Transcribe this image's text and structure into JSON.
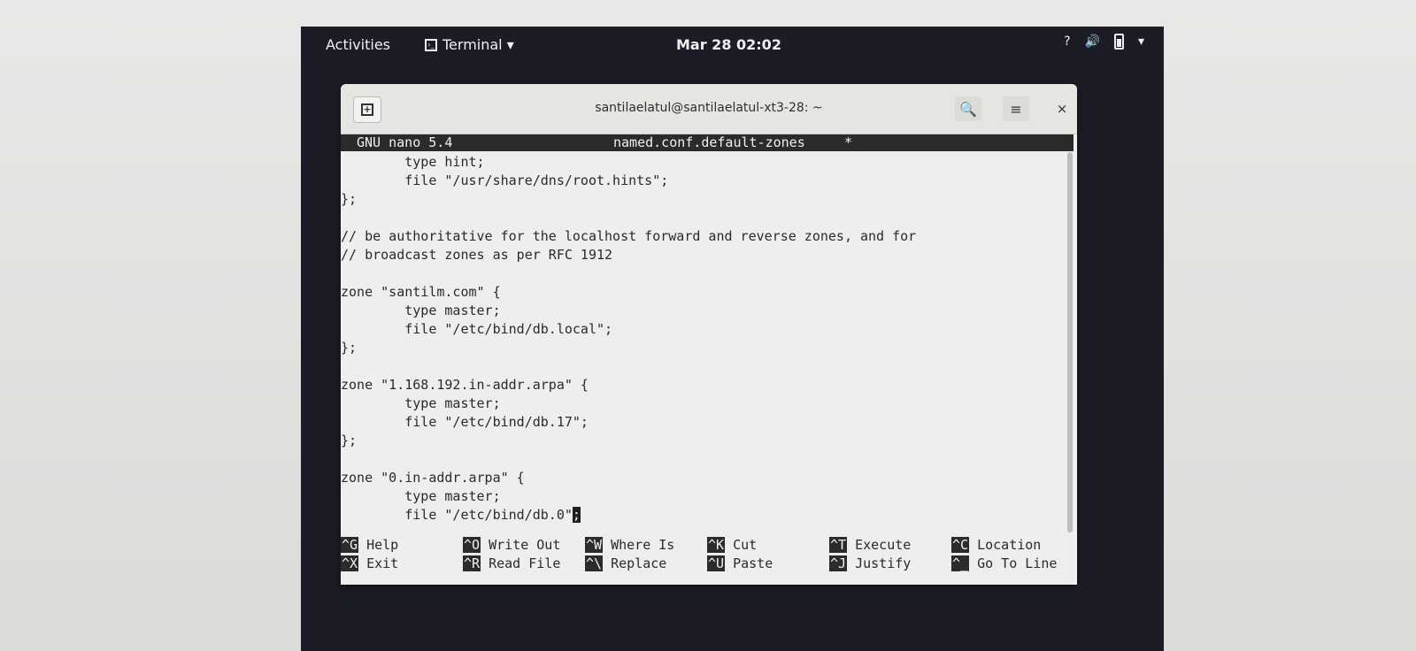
{
  "topbar": {
    "activities": "Activities",
    "app_menu": "Terminal ▾",
    "clock": "Mar 28  02:02",
    "tray_help": "?",
    "tray_volume": "🔊",
    "tray_menu": "▾"
  },
  "window": {
    "title": "santilaelatul@santilaelatul-xt3-28: ~",
    "newtab_glyph": "+",
    "search_glyph": "🔍",
    "menu_glyph": "≡",
    "close_glyph": "×"
  },
  "nano": {
    "version": "GNU nano 5.4",
    "filename": "named.conf.default-zones",
    "modified": "*",
    "lines": [
      "        type hint;",
      "        file \"/usr/share/dns/root.hints\";",
      "};",
      "",
      "// be authoritative for the localhost forward and reverse zones, and for",
      "// broadcast zones as per RFC 1912",
      "",
      "zone \"santilm.com\" {",
      "        type master;",
      "        file \"/etc/bind/db.local\";",
      "};",
      "",
      "zone \"1.168.192.in-addr.arpa\" {",
      "        type master;",
      "        file \"/etc/bind/db.17\";",
      "};",
      "",
      "zone \"0.in-addr.arpa\" {",
      "        type master;"
    ],
    "last_line_text": "        file \"/etc/bind/db.0\"",
    "cursor_char": ";",
    "shortcuts_row1": [
      {
        "key": "^G",
        "label": "Help"
      },
      {
        "key": "^O",
        "label": "Write Out"
      },
      {
        "key": "^W",
        "label": "Where Is"
      },
      {
        "key": "^K",
        "label": "Cut"
      },
      {
        "key": "^T",
        "label": "Execute"
      },
      {
        "key": "^C",
        "label": "Location"
      }
    ],
    "shortcuts_row2": [
      {
        "key": "^X",
        "label": "Exit"
      },
      {
        "key": "^R",
        "label": "Read File"
      },
      {
        "key": "^\\",
        "label": "Replace"
      },
      {
        "key": "^U",
        "label": "Paste"
      },
      {
        "key": "^J",
        "label": "Justify"
      },
      {
        "key": "^_",
        "label": "Go To Line"
      }
    ]
  }
}
